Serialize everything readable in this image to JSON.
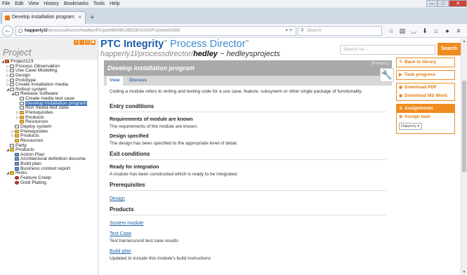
{
  "browser": {
    "menu": [
      "File",
      "Edit",
      "View",
      "History",
      "Bookmarks",
      "Tools",
      "Help"
    ],
    "tab_title": "Develop installation program",
    "url_host": "happerly1l",
    "url_rest": "/processdirector/hedley/Project/6849fc3852801010/Frameid/1656",
    "search_placeholder": "Search",
    "window_controls": [
      "—",
      "□",
      "✕"
    ]
  },
  "left_panel": {
    "title": "Project",
    "tree": [
      {
        "label": "Project123",
        "depth": 0,
        "toggle": "◢",
        "icon": "proj"
      },
      {
        "label": "Process Observation",
        "depth": 1,
        "toggle": "▷",
        "icon": "doc"
      },
      {
        "label": "Use Case Modeling",
        "depth": 1,
        "toggle": "▷",
        "icon": "doc"
      },
      {
        "label": "Design",
        "depth": 1,
        "toggle": "▷",
        "icon": "doc"
      },
      {
        "label": "Prototype",
        "depth": 1,
        "toggle": "▷",
        "icon": "doc"
      },
      {
        "label": "Create installation media",
        "depth": 1,
        "toggle": "▷",
        "icon": "doc"
      },
      {
        "label": "Rollout system",
        "depth": 1,
        "toggle": "◢",
        "icon": "doc"
      },
      {
        "label": "Release Software",
        "depth": 2,
        "toggle": "◢",
        "icon": "doc"
      },
      {
        "label": "Create media test case",
        "depth": 3,
        "toggle": "",
        "icon": "doc"
      },
      {
        "label": "Develop installation program",
        "depth": 3,
        "toggle": "",
        "icon": "doc",
        "selected": true
      },
      {
        "label": "Run media test case",
        "depth": 3,
        "toggle": "",
        "icon": "doc"
      },
      {
        "label": "Prerequisites",
        "depth": 3,
        "toggle": "▷",
        "icon": "folder"
      },
      {
        "label": "Products",
        "depth": 3,
        "toggle": "▷",
        "icon": "folder"
      },
      {
        "label": "Resources",
        "depth": 3,
        "toggle": "",
        "icon": "folder"
      },
      {
        "label": "Deploy system",
        "depth": 2,
        "toggle": "",
        "icon": "doc"
      },
      {
        "label": "Prerequisites",
        "depth": 2,
        "toggle": "▷",
        "icon": "folder"
      },
      {
        "label": "Products",
        "depth": 2,
        "toggle": "▷",
        "icon": "folder"
      },
      {
        "label": "Resources",
        "depth": 2,
        "toggle": "",
        "icon": "folder"
      },
      {
        "label": "Party",
        "depth": 1,
        "toggle": "",
        "icon": "doc"
      },
      {
        "label": "Products",
        "depth": 1,
        "toggle": "◢",
        "icon": "folder"
      },
      {
        "label": "Action Plan",
        "depth": 2,
        "toggle": "",
        "icon": "task"
      },
      {
        "label": "Architectural definition docume",
        "depth": 2,
        "toggle": "",
        "icon": "task"
      },
      {
        "label": "Build plan",
        "depth": 2,
        "toggle": "",
        "icon": "task"
      },
      {
        "label": "Business context report",
        "depth": 2,
        "toggle": "",
        "icon": "task"
      },
      {
        "label": "Risks",
        "depth": 1,
        "toggle": "◢",
        "icon": "folder"
      },
      {
        "label": "Feature Creep",
        "depth": 2,
        "toggle": "",
        "icon": "risk"
      },
      {
        "label": "Gold Plating",
        "depth": 2,
        "toggle": "",
        "icon": "risk"
      }
    ]
  },
  "header": {
    "logo_brand": "PTC Integrity",
    "logo_tm1": "™",
    "logo_product": " Process Director",
    "logo_tm2": "™",
    "path_prefix": "happerly1l/processdirector/",
    "path_user": "hedley",
    "path_suffix": " ~ hedleysprojects",
    "search_placeholder": "Search for...",
    "search_button": "Search"
  },
  "main": {
    "title": "Develop installation program",
    "type_label": "(Process)",
    "tabs": [
      "View",
      "Discuss"
    ],
    "description": "Coding a module refers to writing and testing code for a use case, feature, subsystem or other single package of functionality.",
    "entry_conditions": {
      "heading": "Entry conditions",
      "items": [
        {
          "title": "Requirements of module are known",
          "desc": "The requirements of the module are known."
        },
        {
          "title": "Design specified",
          "desc": "The design has been specified to the appropriate level of detail."
        }
      ]
    },
    "exit_conditions": {
      "heading": "Exit conditions",
      "items": [
        {
          "title": "Ready for integration",
          "desc": "A module has been constructed which is ready to be integrated."
        }
      ]
    },
    "prerequisites": {
      "heading": "Prerequisites",
      "links": [
        "Design"
      ]
    },
    "products": {
      "heading": "Products",
      "items": [
        {
          "link": "System module",
          "desc": ""
        },
        {
          "link": "Test Case",
          "desc": "Test harness/unit test case results"
        },
        {
          "link": "Build plan",
          "desc": "Updated to include this module's build instructions"
        }
      ]
    }
  },
  "right_panel": {
    "back_to_library": "Back to library",
    "task_progress": "Task progress",
    "download_pdf": "Download PDF",
    "download_word": "Download MS Word",
    "assignments": "Assignments",
    "assign_task": "Assign task",
    "user_select": "Happerly"
  },
  "colors": {
    "accent_orange": "#f08c1e",
    "brand_blue": "#1b5ea8",
    "title_grey": "#a9a9a9"
  }
}
